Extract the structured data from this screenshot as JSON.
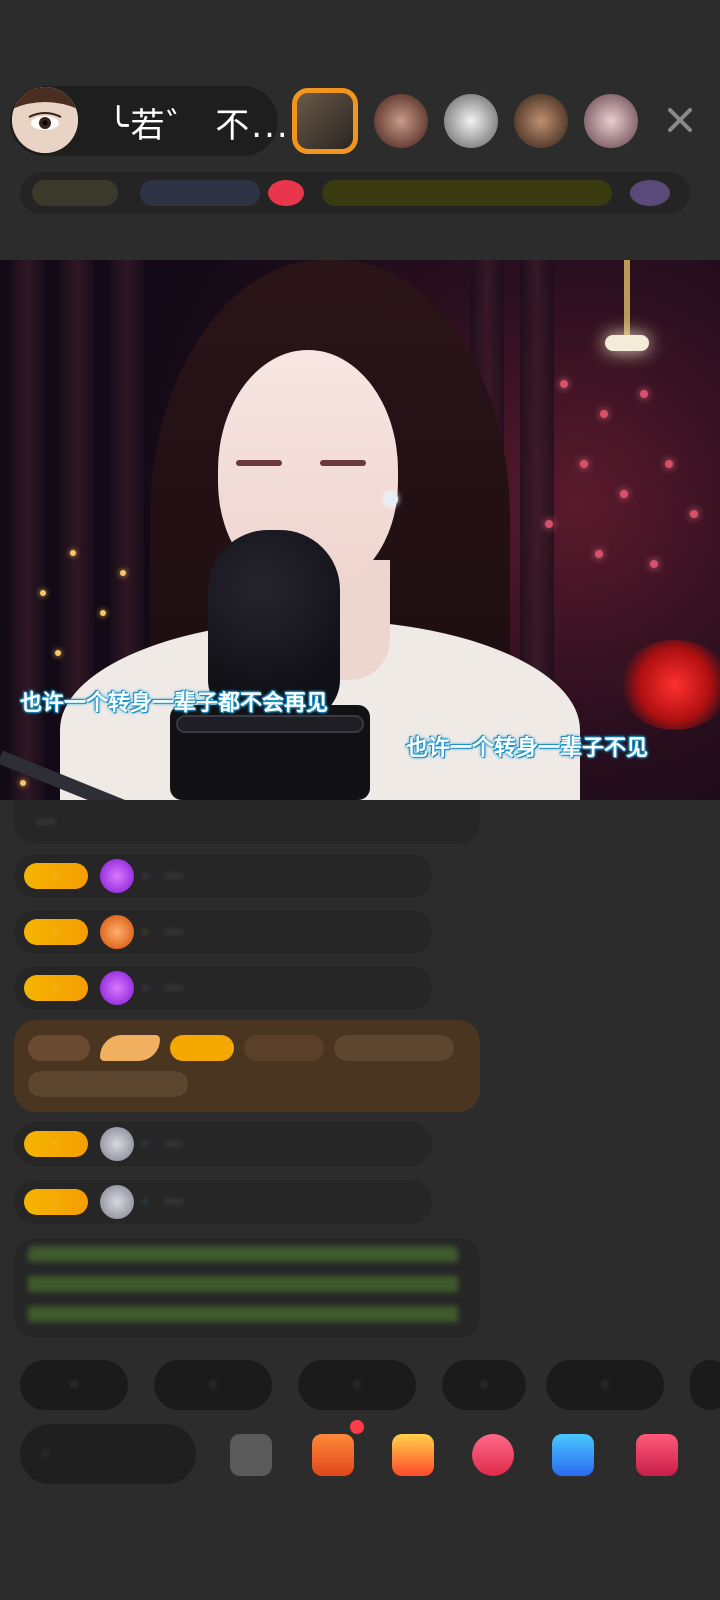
{
  "header": {
    "host_name": "╰若゛ 不...",
    "close_icon": "close-icon",
    "viewer_avatar_count": 5
  },
  "video": {
    "lyric_left": "也许一个转身一辈子都不会再见",
    "lyric_right": "也许一个转身一辈子不见"
  },
  "chat": {
    "messages": [
      {
        "name": "·",
        "text": "···"
      },
      {
        "badge": "·",
        "name": "·",
        "text": "···"
      },
      {
        "badge": "·",
        "name": "·",
        "text": "···"
      },
      {
        "badge": "·",
        "name": "·",
        "text": "···"
      },
      {
        "badge": "·",
        "name": "·",
        "text": "···"
      },
      {
        "badge": "·",
        "name": "·",
        "text": "···"
      }
    ]
  },
  "quick_chips": [
    "·",
    "·",
    "·",
    "·",
    "·"
  ],
  "bottom": {
    "input_placeholder": "·"
  },
  "colors": {
    "background": "#2c2c2c",
    "level_badge": "#f5b400",
    "highlight_card": "#4a3520",
    "lyric_outline": "#1a9fd6"
  }
}
